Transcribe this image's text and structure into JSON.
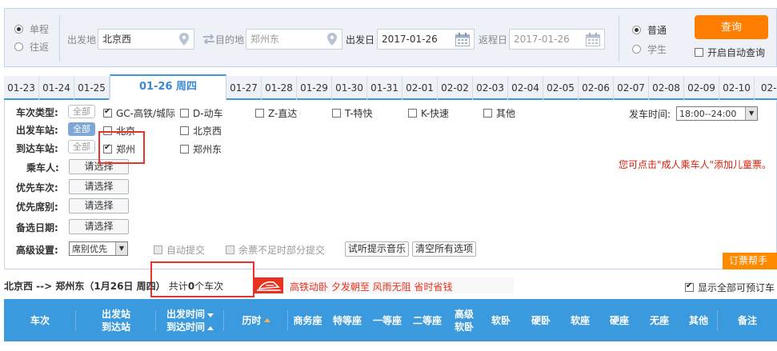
{
  "search": {
    "trip_types": [
      "单程",
      "往返"
    ],
    "trip_selected": "单程",
    "from_label": "出发地",
    "from_value": "北京西",
    "to_label": "目的地",
    "to_value": "郑州东",
    "depart_label": "出发日",
    "depart_value": "2017-01-26",
    "return_label": "返程日",
    "return_value": "2017-01-26",
    "passenger_types": [
      "普通",
      "学生"
    ],
    "passenger_selected": "普通",
    "query_label": "查询",
    "auto_query_label": "开启自动查询"
  },
  "date_tabs": [
    {
      "label": "01-23",
      "active": false
    },
    {
      "label": "01-24",
      "active": false
    },
    {
      "label": "01-25",
      "active": false
    },
    {
      "label": "01-26 周四",
      "active": true
    },
    {
      "label": "01-27",
      "active": false
    },
    {
      "label": "01-28",
      "active": false
    },
    {
      "label": "01-29",
      "active": false
    },
    {
      "label": "01-30",
      "active": false
    },
    {
      "label": "01-31",
      "active": false
    },
    {
      "label": "02-01",
      "active": false
    },
    {
      "label": "02-02",
      "active": false
    },
    {
      "label": "02-03",
      "active": false
    },
    {
      "label": "02-04",
      "active": false
    },
    {
      "label": "02-05",
      "active": false
    },
    {
      "label": "02-06",
      "active": false
    },
    {
      "label": "02-07",
      "active": false
    },
    {
      "label": "02-08",
      "active": false
    },
    {
      "label": "02-09",
      "active": false
    },
    {
      "label": "02-10",
      "active": false
    },
    {
      "label": "02-1",
      "active": false
    }
  ],
  "filters": {
    "train_type_label": "车次类型:",
    "all_label": "全部",
    "train_types": [
      {
        "label": "GC-高铁/城际",
        "checked": true
      },
      {
        "label": "D-动车",
        "checked": false
      },
      {
        "label": "Z-直达",
        "checked": false
      },
      {
        "label": "T-特快",
        "checked": false
      },
      {
        "label": "K-快速",
        "checked": false
      },
      {
        "label": "其他",
        "checked": false
      }
    ],
    "from_station_label": "出发车站:",
    "from_stations": [
      {
        "label": "北京",
        "checked": false
      },
      {
        "label": "北京西",
        "checked": false
      }
    ],
    "to_station_label": "到达车站:",
    "to_stations": [
      {
        "label": "郑州",
        "checked": true
      },
      {
        "label": "郑州东",
        "checked": false
      }
    ],
    "passenger_label": "乘车人:",
    "priority_train_label": "优先车次:",
    "priority_seat_label": "优先席别:",
    "backup_date_label": "备选日期:",
    "choose_label": "请选择",
    "depart_time_label": "发车时间:",
    "depart_time_value": "18:00--24:00",
    "child_note": "您可点击\"成人乘车人\"添加儿童票。",
    "advanced_label": "高级设置:",
    "advanced_select": "席别优先",
    "auto_submit_label": "自动提交",
    "partial_submit_label": "余票不足时部分提交",
    "music_btn": "试听提示音乐",
    "clear_btn": "清空所有选项",
    "help_label": "订票帮手"
  },
  "route": {
    "summary": "北京西 --> 郑州东（1月26日  周四）",
    "count_prefix": "共计",
    "count": "0",
    "count_suffix": "个车次",
    "promo": "高铁动卧 夕发朝至 风雨无阻 省时省钱",
    "show_all_label": "显示全部可预订车"
  },
  "table_headers": {
    "train_no": "车次",
    "station_line1": "出发站",
    "station_line2": "到达站",
    "time_line1": "出发时间",
    "time_line2": "到达时间",
    "duration": "历时",
    "business": "商务座",
    "special": "特等座",
    "first": "一等座",
    "second": "二等座",
    "adv_soft_line1": "高级",
    "adv_soft_line2": "软卧",
    "soft_sleeper": "软卧",
    "hard_sleeper": "硬卧",
    "soft_seat": "软座",
    "hard_seat": "硬座",
    "no_seat": "无座",
    "other": "其他",
    "remark": "备注"
  },
  "colors": {
    "accent_blue": "#3b9ade",
    "query_orange": "#ff7e00",
    "annotation_red": "#e8322a"
  }
}
